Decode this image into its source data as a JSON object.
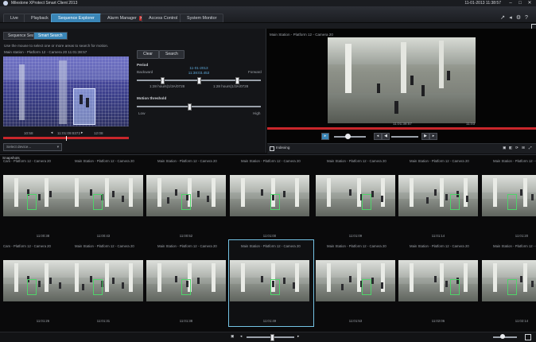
{
  "titlebar": {
    "title": "Milestone XProtect Smart Client 2013",
    "clock": "11-01-2013 11:38:57",
    "window_buttons": [
      "–",
      "□",
      "✕"
    ]
  },
  "tabs": [
    {
      "label": "Live",
      "active": false
    },
    {
      "label": "Playback",
      "active": false
    },
    {
      "label": "Sequence Explorer",
      "active": true
    },
    {
      "label": "Alarm Manager",
      "active": false,
      "badge": "✕"
    },
    {
      "label": "Access Control",
      "active": false
    },
    {
      "label": "System Monitor",
      "active": false
    }
  ],
  "toolbar_icons": [
    "↗",
    "◂",
    "⚙",
    "?"
  ],
  "left": {
    "subtabs": [
      {
        "label": "Sequence Search",
        "active": false
      },
      {
        "label": "Smart Search",
        "active": true
      }
    ],
    "hint": "Use the mouse to select one or more areas to search for motion.",
    "camera_label": "Main station - Platform 12 - Camera 20  11:01:38:57",
    "clear_label": "Clear",
    "search_label": "Search",
    "period": {
      "heading": "Period",
      "backward": "Backward",
      "forward": "Forward",
      "center_time_1": "11-01-2013",
      "center_time_2": "11:38:03.453",
      "left_bound": "1:28 hours(1/3A/0728",
      "right_bound": "1:28 hours(1/3A/0728"
    },
    "motion": {
      "heading": "Motion threshold",
      "low": "Low",
      "high": "High",
      "value": 0.42
    },
    "nav": {
      "prev": "◂",
      "time": "11:01:09:8372",
      "next": "▸",
      "left_time": "10:58",
      "right_time": "12:08"
    },
    "select_device": "Select device..."
  },
  "right": {
    "camera_label": "Main Station - Platform 12 - Camera 20",
    "time_left": "11:01:38:57",
    "time_right": "11:03",
    "indexing": "Indexing",
    "icons": [
      "▣",
      "◧",
      "⟳",
      "⊞",
      "⤢"
    ]
  },
  "snapshots": {
    "header": "Snapshots",
    "row1_labels": [
      "Cam - Platform 12 - Camera 20",
      "Main Station - Platform 12 - Camera 20",
      "Main Station - Platform 12 - Camera 20",
      "Main Station - Platform 12 - Camera 20",
      "Main Station - Platform 12 - Camera 20",
      "Main Station - Platform 12 - Camera 20",
      "Main Station - Platform 12 - Camera 20"
    ],
    "row1_times": [
      "11:00:38",
      "11:00:43",
      "11:00:52",
      "11:01:00",
      "11:01:09",
      "11:01:14",
      "11:01:20"
    ],
    "row2_labels": [
      "Cam - Platform 12 - Camera 20",
      "Main Station - Platform 12 - Camera 20",
      "Main Station - Platform 12 - Camera 20",
      "Main Station - Platform 12 - Camera 20",
      "Main Station - Platform 12 - Camera 20",
      "Main Station - Platform 12 - Camera 20",
      "Main Station - Platform 12 - Camera 20"
    ],
    "row2_times": [
      "11:01:26",
      "11:01:31",
      "11:01:38",
      "11:01:49",
      "11:01:53",
      "11:02:06",
      "11:02:14"
    ]
  },
  "bottom": {
    "icons": [
      "▣",
      "◂",
      "▸"
    ],
    "zoom": 0.4
  },
  "colors": {
    "accent": "#3a86b7",
    "timeline_red": "#c9262b",
    "selection": "#74c3e4",
    "motion_box": "#4fd36a"
  }
}
